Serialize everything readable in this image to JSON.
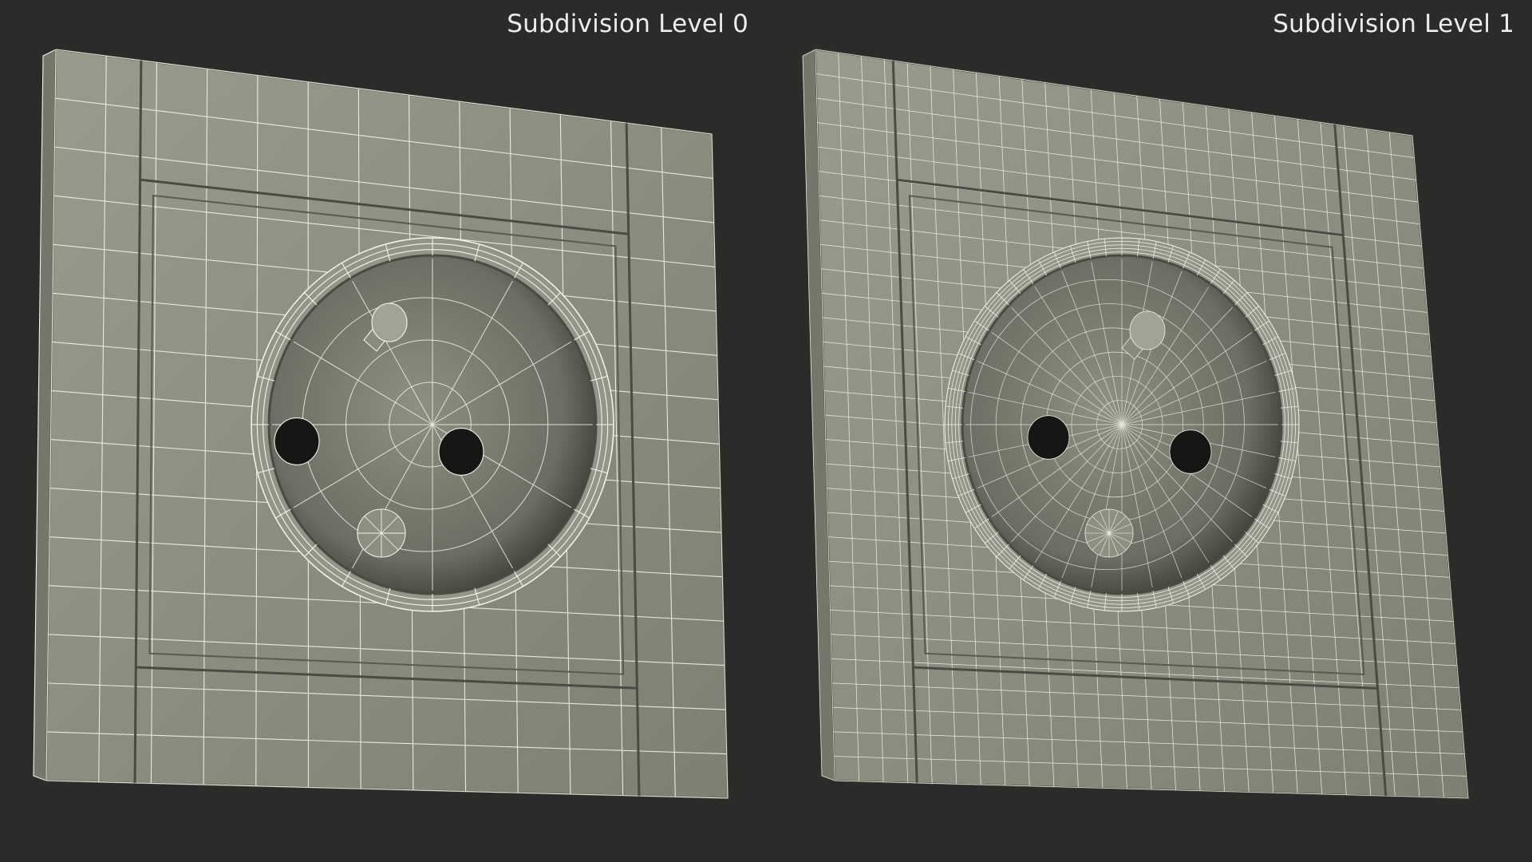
{
  "panels": [
    {
      "caption": "Subdivision Level 0",
      "mesh_density": "low"
    },
    {
      "caption": "Subdivision Level 1",
      "mesh_density": "high"
    }
  ],
  "colors": {
    "background": "#2b2b2a",
    "surface": "#8c8c7f",
    "wireframe": "#f3f3ea",
    "caption": "#ececec"
  }
}
